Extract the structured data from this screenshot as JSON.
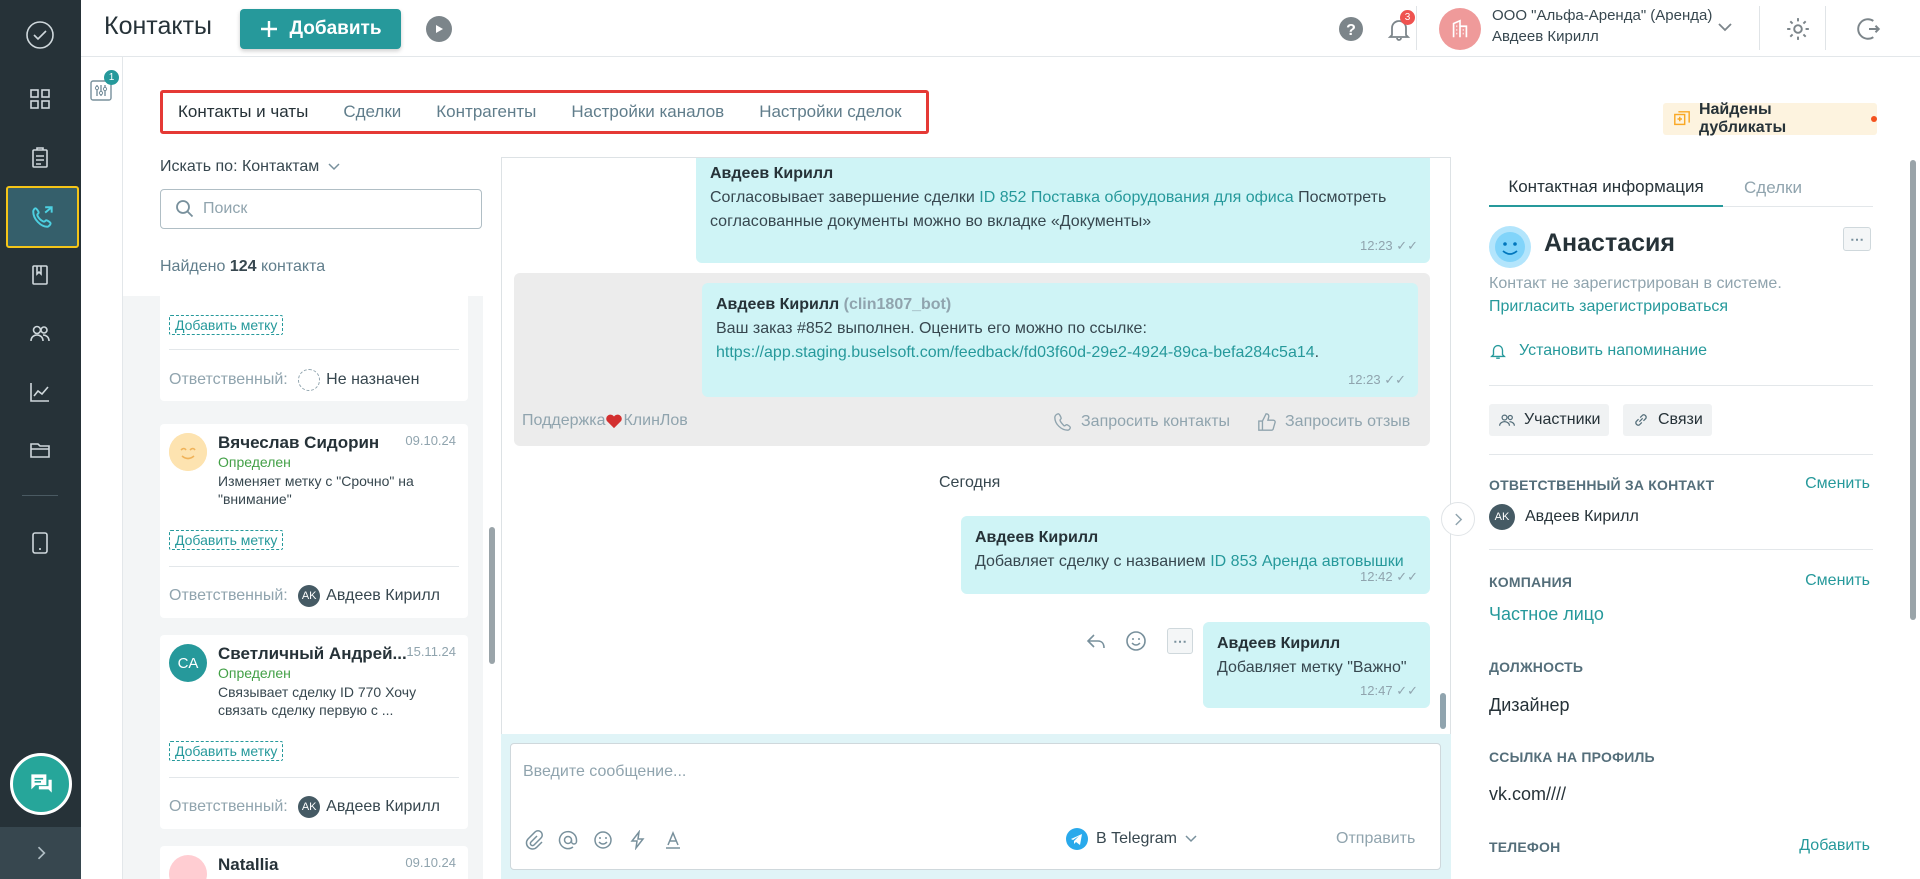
{
  "header": {
    "title": "Контакты",
    "add_label": "Добавить",
    "notif_count": "3",
    "org_name": "ООО \"Альфа-Аренда\" (Аренда)",
    "user_name": "Авдеев Кирилл"
  },
  "filter": {
    "badge": "1"
  },
  "tabs": [
    {
      "label": "Контакты и чаты"
    },
    {
      "label": "Сделки"
    },
    {
      "label": "Контрагенты"
    },
    {
      "label": "Настройки каналов"
    },
    {
      "label": "Настройки сделок"
    }
  ],
  "duplicates": {
    "label": "Найдены дубликаты"
  },
  "list": {
    "search_by": "Искать по: Контактам",
    "search_placeholder": "Поиск",
    "found_prefix": "Найдено",
    "found_count": "124",
    "found_suffix": "контакта",
    "tag_label": "Добавить метку",
    "responsible_label": "Ответственный:",
    "card0": {
      "responsible": "Не назначен"
    },
    "contacts": [
      {
        "name": "Вячеслав Сидорин",
        "date": "09.10.24",
        "status": "Определен",
        "message": "Изменяет метку с \"Срочно\" на \"внимание\"",
        "responsible": "Авдеев Кирилл",
        "resp_initials": "AK"
      },
      {
        "name": "Светличный Андрей...",
        "date": "15.11.24",
        "status": "Определен",
        "message": "Связывает сделку ID 770 Хочу связать сделку первую с ...",
        "responsible": "Авдеев Кирилл",
        "resp_initials": "AK",
        "initials": "CA"
      },
      {
        "name": "Natallia",
        "date": "09.10.24"
      }
    ]
  },
  "chat": {
    "m1": {
      "from": "Авдеев Кирилл",
      "text1": "Согласовывает завершение сделки",
      "link": "ID 852 Поставка оборудования для офиса",
      "text2": "Посмотреть",
      "text3": "согласованные документы можно во вкладке «Документы»",
      "time": "12:23"
    },
    "m2": {
      "from": "Авдеев Кирилл",
      "bot": "(clin1807_bot)",
      "text": "Ваш заказ #852 выполнен. Оценить его можно по ссылке:",
      "link": "https://app.staging.buselsoft.com/feedback/fd03f60d-29e2-4924-89ca-befa284c5a14",
      "link_end": ".",
      "time": "12:23"
    },
    "channel_a": "Поддержка",
    "channel_b": "КлинЛов",
    "request_contacts": "Запросить контакты",
    "request_review": "Запросить отзыв",
    "divider": "Сегодня",
    "m3": {
      "from": "Авдеев Кирилл",
      "text": "Добавляет сделку с названием",
      "link": "ID 853 Аренда автовышки",
      "time": "12:42"
    },
    "m4": {
      "from": "Авдеев Кирилл",
      "text": "Добавляет метку \"Важно\"",
      "time": "12:47"
    },
    "compose": {
      "placeholder": "Введите сообщение...",
      "channel": "В Telegram",
      "send": "Отправить"
    }
  },
  "contact": {
    "tab_info": "Контактная информация",
    "tab_deals": "Сделки",
    "name": "Анастасия",
    "not_registered": "Контакт не зарегистрирован в системе.",
    "invite": "Пригласить зарегистрироваться",
    "reminder": "Установить напоминание",
    "participants": "Участники",
    "links": "Связи",
    "responsible_label": "ОТВЕТСТВЕННЫЙ ЗА КОНТАКТ",
    "change": "Сменить",
    "responsible": "Авдеев Кирилл",
    "resp_initials": "AK",
    "company_label": "КОМПАНИЯ",
    "company": "Частное лицо",
    "position_label": "ДОЛЖНОСТЬ",
    "position": "Дизайнер",
    "profile_label": "ССЫЛКА НА ПРОФИЛЬ",
    "profile": "vk.com////",
    "phone_label": "ТЕЛЕФОН",
    "add": "Добавить"
  },
  "colors": {
    "accent": "#26999b",
    "rail": "#263238",
    "bubble": "#cff4f6",
    "highlight": "#e53935"
  }
}
